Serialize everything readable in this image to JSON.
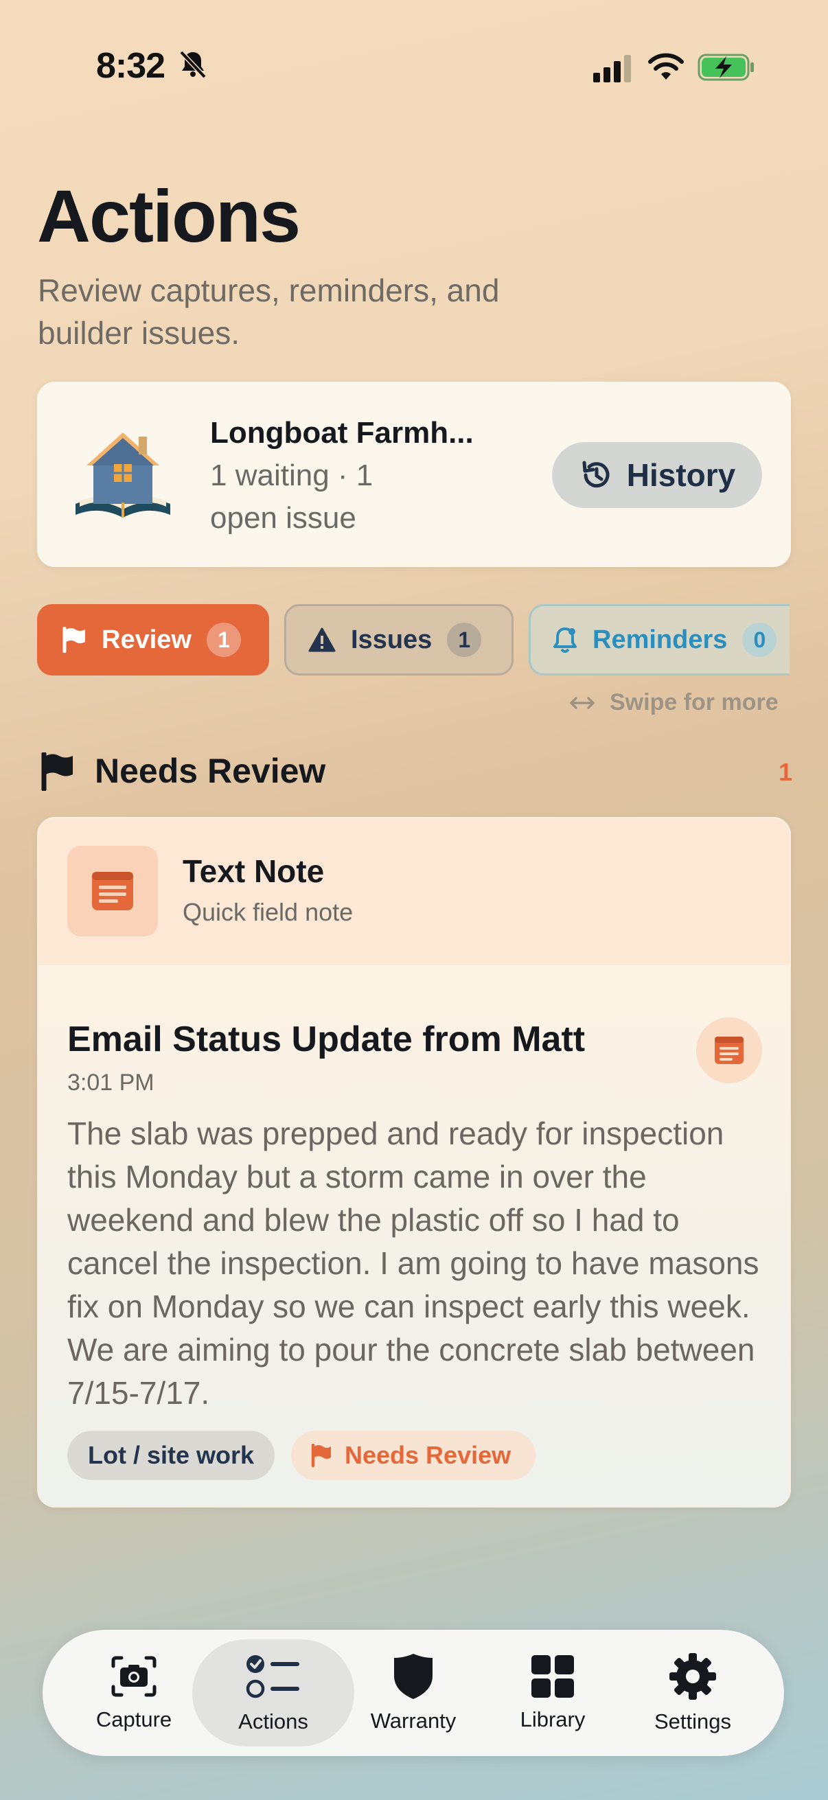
{
  "status_bar": {
    "time": "8:32",
    "icons": [
      "bell-slash-icon",
      "cellular-signal-icon",
      "wifi-icon",
      "battery-charging-icon"
    ]
  },
  "header": {
    "title": "Actions",
    "subtitle": "Review captures, reminders, and builder issues."
  },
  "project": {
    "name": "Longboat Farmh...",
    "meta": "1 waiting · 1 open issue",
    "icon": "house-book-icon",
    "history_label": "History"
  },
  "tabs": [
    {
      "label": "Review",
      "count": "1",
      "icon": "flag-icon"
    },
    {
      "label": "Issues",
      "count": "1",
      "icon": "warning-icon"
    },
    {
      "label": "Reminders",
      "count": "0",
      "icon": "bell-icon"
    }
  ],
  "swipe_hint": "Swipe for more",
  "section": {
    "title": "Needs Review",
    "count": "1"
  },
  "note": {
    "type": "Text Note",
    "type_sub": "Quick field note",
    "title": "Email Status Update from Matt",
    "time": "3:01 PM",
    "body": "The slab was prepped and ready for inspection this Monday but a storm came in over the weekend and blew the plastic off so I had to cancel the inspection.  I am going to have masons fix on Monday so we can inspect early this week.  We are aiming to pour the concrete slab between 7/15-7/17.",
    "chips": [
      "Lot / site work",
      "Needs Review"
    ]
  },
  "nav": [
    {
      "label": "Capture",
      "icon": "camera-icon"
    },
    {
      "label": "Actions",
      "icon": "checklist-icon",
      "active": true
    },
    {
      "label": "Warranty",
      "icon": "shield-icon"
    },
    {
      "label": "Library",
      "icon": "grid-icon"
    },
    {
      "label": "Settings",
      "icon": "gear-icon"
    }
  ],
  "colors": {
    "accent": "#e4683a",
    "navy": "#23344f",
    "reminder_blue": "#2a8fbf"
  }
}
